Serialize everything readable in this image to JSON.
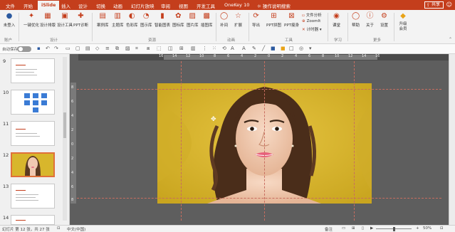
{
  "tabs": [
    {
      "label": "文件"
    },
    {
      "label": "开始"
    },
    {
      "label": "iSlide"
    },
    {
      "label": "插入"
    },
    {
      "label": "设计"
    },
    {
      "label": "切换"
    },
    {
      "label": "动画"
    },
    {
      "label": "幻灯片放映"
    },
    {
      "label": "审阅"
    },
    {
      "label": "视图"
    },
    {
      "label": "开发工具"
    },
    {
      "label": "OneKey 10"
    },
    {
      "label": "操作说明搜索"
    }
  ],
  "share_label": "共享",
  "ribbon": {
    "user_label": "未登入",
    "account_label": "账户",
    "group_design": "设计",
    "group_resources": "资源",
    "group_animation": "动画",
    "group_tools": "工具",
    "group_learn": "学习",
    "group_more": "更多",
    "buttons": {
      "one_click": "一键优化",
      "design_layout": "设计排版",
      "design_tools": "设计工具",
      "ppt_diagnosis": "PPT诊断",
      "cases": "案例库",
      "themes": "主题库",
      "colors": "色彩库",
      "icons": "图示库",
      "smart_charts": "智能图表",
      "icon_lib": "图标库",
      "image_lib": "图片库",
      "illustration_lib": "插图库",
      "fill": "补间",
      "expand": "扩展",
      "export": "导出",
      "ppt_merge": "PPT拼图",
      "ppt_slim": "PPT瘦身",
      "doc_analysis": "文件分析",
      "zoomit": "ZoomIt",
      "timer": "计时器",
      "classroom": "课堂",
      "help": "帮助",
      "about": "关于",
      "settings": "设置",
      "upgrade": "升级会员"
    }
  },
  "toolbar": {
    "autosave": "自动保存"
  },
  "slides": [
    {
      "num": "9"
    },
    {
      "num": "10"
    },
    {
      "num": "11"
    },
    {
      "num": "12"
    },
    {
      "num": "13"
    },
    {
      "num": "14"
    }
  ],
  "ruler": {
    "h": [
      "16",
      "14",
      "12",
      "10",
      "8",
      "6",
      "4",
      "2",
      "0",
      "2",
      "4",
      "6",
      "8",
      "10",
      "12",
      "14",
      "16"
    ],
    "v": [
      "8",
      "6",
      "4",
      "2",
      "0",
      "2",
      "4",
      "6",
      "8"
    ]
  },
  "status": {
    "slide_info": "幻灯片 第 12 张，共 27 张",
    "language": "中文(中国)",
    "notes": "备注",
    "zoom": "50%"
  },
  "colors": {
    "accent": "#c43e1c",
    "slide_bg": "#d8b62c",
    "canvas": "#5e5e5e"
  }
}
